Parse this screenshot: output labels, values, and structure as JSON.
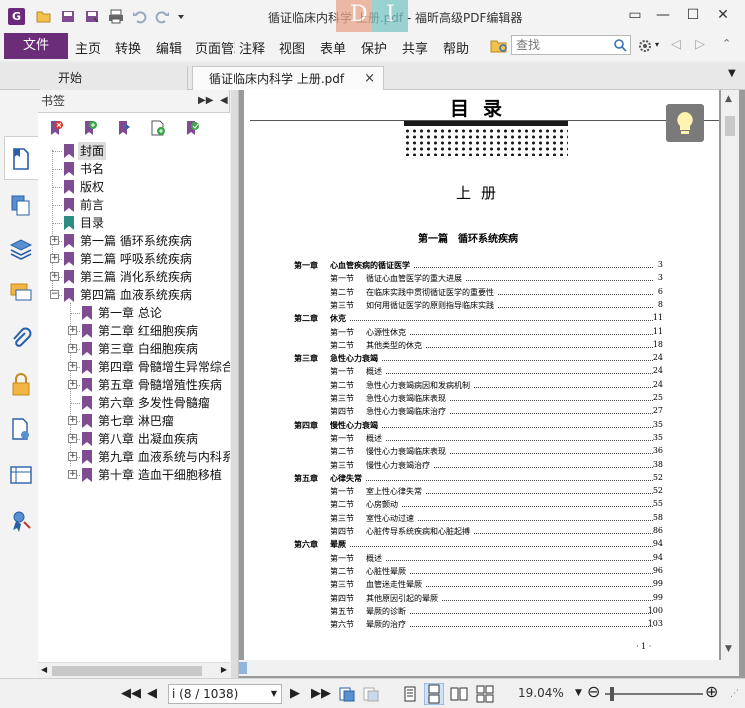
{
  "window": {
    "title": "循证临床内科学 上册.pdf - 福昕高级PDF编辑器",
    "app_icon": "G",
    "watermark_letters": [
      "D",
      "I"
    ]
  },
  "menu": {
    "file": "文件",
    "items": [
      "主页",
      "转换",
      "编辑",
      "页面管理",
      "注释",
      "视图",
      "表单",
      "保护",
      "共享",
      "帮助"
    ]
  },
  "search": {
    "placeholder": "查找"
  },
  "tabs": {
    "start": "开始",
    "doc": "循证临床内科学 上册.pdf",
    "close": "×"
  },
  "bookmarks_panel": {
    "header": "书签",
    "items": [
      {
        "label": "封面",
        "selected": true
      },
      {
        "label": "书名"
      },
      {
        "label": "版权"
      },
      {
        "label": "前言"
      },
      {
        "label": "目录",
        "teal": true
      },
      {
        "label": "第一篇 循环系统疾病",
        "expandable": true
      },
      {
        "label": "第二篇 呼吸系统疾病",
        "expandable": true
      },
      {
        "label": "第三篇 消化系统疾病",
        "expandable": true
      },
      {
        "label": "第四篇 血液系统疾病",
        "expanded": true
      },
      {
        "label": "第一章 总论",
        "child": true
      },
      {
        "label": "第二章 红细胞疾病",
        "child": true,
        "expandable": true
      },
      {
        "label": "第三章 白细胞疾病",
        "child": true,
        "expandable": true
      },
      {
        "label": "第四章 骨髓增生异常综合",
        "child": true,
        "expandable": true
      },
      {
        "label": "第五章 骨髓增殖性疾病",
        "child": true,
        "expandable": true
      },
      {
        "label": "第六章 多发性骨髓瘤",
        "child": true
      },
      {
        "label": "第七章 淋巴瘤",
        "child": true,
        "expandable": true
      },
      {
        "label": "第八章 出凝血疾病",
        "child": true,
        "expandable": true
      },
      {
        "label": "第九章 血液系统与内科系",
        "child": true,
        "expandable": true
      },
      {
        "label": "第十章 造血干细胞移植",
        "child": true,
        "expandable": true
      }
    ]
  },
  "pdf_page": {
    "heading": "目录",
    "volume": "上册",
    "part": "第一篇　循环系统疾病",
    "toc": [
      {
        "type": "chapter",
        "num": "第一章",
        "title": "心血管疾病的循证医学",
        "page": "3"
      },
      {
        "type": "section",
        "num": "第一节",
        "title": "循证心血管医学的重大进展",
        "page": "3"
      },
      {
        "type": "section",
        "num": "第二节",
        "title": "在临床实践中贯彻循证医学的重要性",
        "page": "6"
      },
      {
        "type": "section",
        "num": "第三节",
        "title": "如何用循证医学的原则指导临床实践",
        "page": "8"
      },
      {
        "type": "chapter",
        "num": "第二章",
        "title": "休克",
        "page": "11"
      },
      {
        "type": "section",
        "num": "第一节",
        "title": "心源性休克",
        "page": "11"
      },
      {
        "type": "section",
        "num": "第二节",
        "title": "其他类型的休克",
        "page": "18"
      },
      {
        "type": "chapter",
        "num": "第三章",
        "title": "急性心力衰竭",
        "page": "24"
      },
      {
        "type": "section",
        "num": "第一节",
        "title": "概述",
        "page": "24"
      },
      {
        "type": "section",
        "num": "第二节",
        "title": "急性心力衰竭病因和发病机制",
        "page": "24"
      },
      {
        "type": "section",
        "num": "第三节",
        "title": "急性心力衰竭临床表现",
        "page": "25"
      },
      {
        "type": "section",
        "num": "第四节",
        "title": "急性心力衰竭临床治疗",
        "page": "27"
      },
      {
        "type": "chapter",
        "num": "第四章",
        "title": "慢性心力衰竭",
        "page": "35"
      },
      {
        "type": "section",
        "num": "第一节",
        "title": "概述",
        "page": "35"
      },
      {
        "type": "section",
        "num": "第二节",
        "title": "慢性心力衰竭临床表现",
        "page": "36"
      },
      {
        "type": "section",
        "num": "第三节",
        "title": "慢性心力衰竭治疗",
        "page": "38"
      },
      {
        "type": "chapter",
        "num": "第五章",
        "title": "心律失常",
        "page": "52"
      },
      {
        "type": "section",
        "num": "第一节",
        "title": "室上性心律失常",
        "page": "52"
      },
      {
        "type": "section",
        "num": "第二节",
        "title": "心房颤动",
        "page": "55"
      },
      {
        "type": "section",
        "num": "第三节",
        "title": "室性心动过速",
        "page": "58"
      },
      {
        "type": "section",
        "num": "第四节",
        "title": "心脏传导系统疾病和心脏起搏",
        "page": "86"
      },
      {
        "type": "chapter",
        "num": "第六章",
        "title": "晕厥",
        "page": "94"
      },
      {
        "type": "section",
        "num": "第一节",
        "title": "概述",
        "page": "94"
      },
      {
        "type": "section",
        "num": "第二节",
        "title": "心脏性晕厥",
        "page": "96"
      },
      {
        "type": "section",
        "num": "第三节",
        "title": "血管迷走性晕厥",
        "page": "99"
      },
      {
        "type": "section",
        "num": "第四节",
        "title": "其他原因引起的晕厥",
        "page": "99"
      },
      {
        "type": "section",
        "num": "第五节",
        "title": "晕厥的诊断",
        "page": "100"
      },
      {
        "type": "section",
        "num": "第六节",
        "title": "晕厥的治疗",
        "page": "103"
      }
    ],
    "footer": "· 1 ·"
  },
  "statusbar": {
    "page_field": "i (8 / 1038)",
    "zoom": "19.04%"
  },
  "colors": {
    "accent": "#6b2d78",
    "bookmark": "#7f4c92",
    "bookmark_teal": "#2e8b84"
  }
}
